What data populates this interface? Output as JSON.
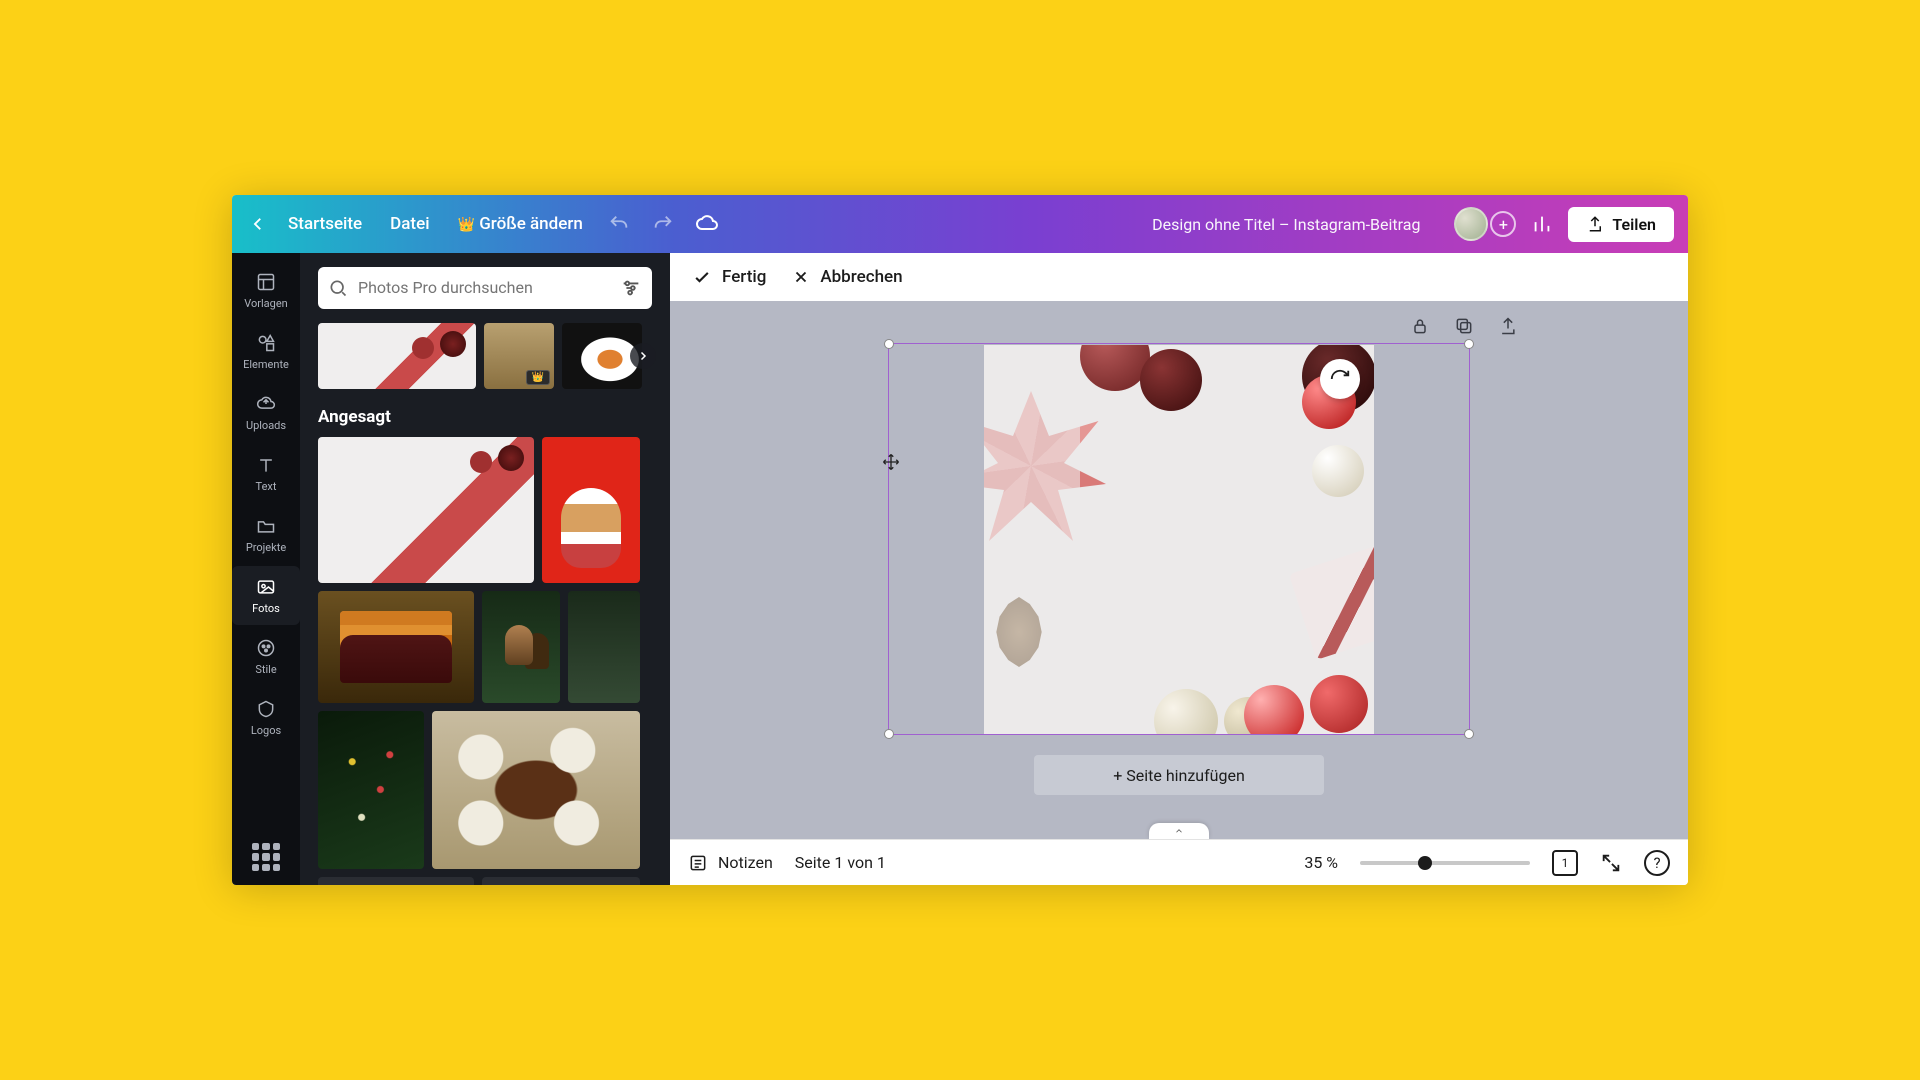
{
  "topbar": {
    "home": "Startseite",
    "file": "Datei",
    "resize": "Größe ändern",
    "title": "Design ohne Titel – Instagram-Beitrag",
    "share": "Teilen"
  },
  "rail": {
    "templates": "Vorlagen",
    "elements": "Elemente",
    "uploads": "Uploads",
    "text": "Text",
    "projects": "Projekte",
    "photos": "Fotos",
    "styles": "Stile",
    "logos": "Logos"
  },
  "panel": {
    "search_placeholder": "Photos Pro durchsuchen",
    "trending": "Angesagt"
  },
  "cropbar": {
    "done": "Fertig",
    "cancel": "Abbrechen"
  },
  "canvas": {
    "add_page": "+ Seite hinzufügen"
  },
  "bottombar": {
    "notes": "Notizen",
    "page_counter": "Seite 1 von 1",
    "zoom": "35 %",
    "page_badge": "1"
  }
}
